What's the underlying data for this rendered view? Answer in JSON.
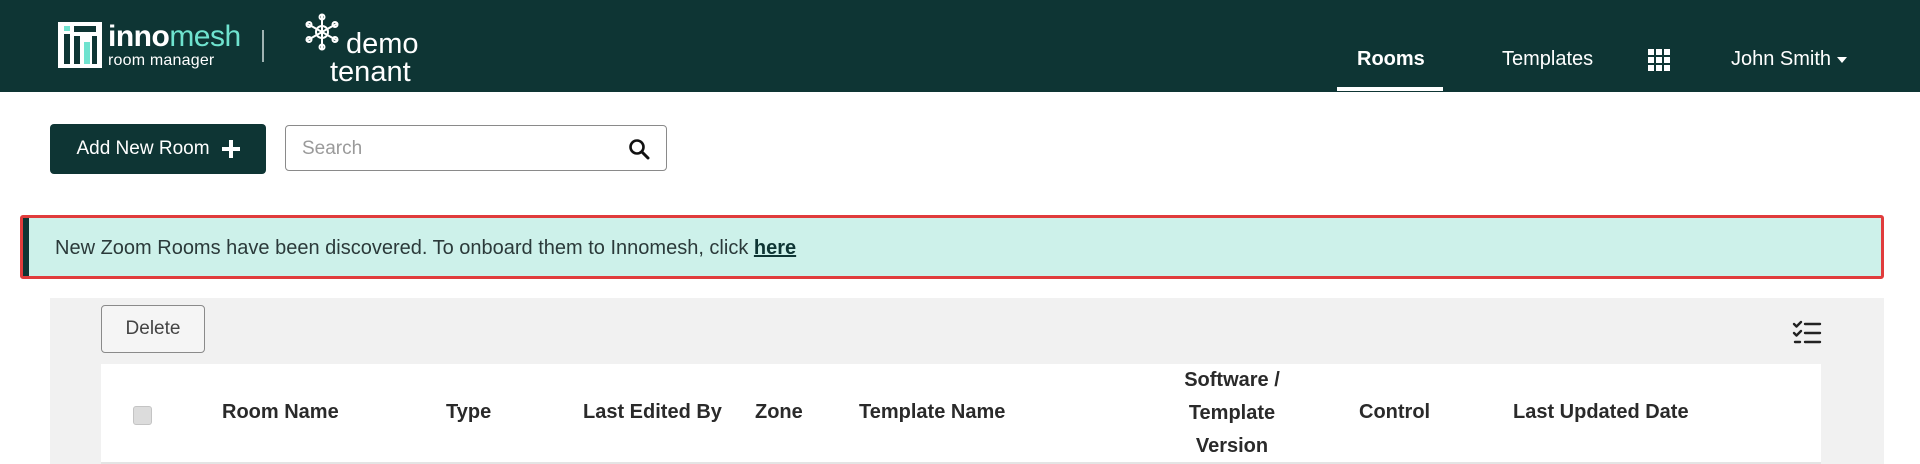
{
  "brand": {
    "name_part1": "inno",
    "name_part2": "mesh",
    "sub": "room manager"
  },
  "tenant": {
    "line1": "demo",
    "line2": "tenant"
  },
  "nav": {
    "rooms": "Rooms",
    "templates": "Templates",
    "user": "John Smith"
  },
  "toolbar": {
    "add_label": "Add New Room",
    "search_placeholder": "Search"
  },
  "alert": {
    "message": "New Zoom Rooms have been discovered. To onboard them to Innomesh, click ",
    "link": "here"
  },
  "table": {
    "delete_label": "Delete",
    "columns": {
      "room_name": "Room Name",
      "type": "Type",
      "last_edited_by": "Last Edited By",
      "zone": "Zone",
      "template_name": "Template Name",
      "software_line1": "Software /",
      "software_line2": "Template",
      "software_line3": "Version",
      "control": "Control",
      "last_updated_date": "Last Updated Date"
    }
  },
  "colors": {
    "header_bg": "#0e3534",
    "accent": "#6fe3cf",
    "alert_bg": "#cdf1ea",
    "alert_border": "#e03c3c"
  }
}
